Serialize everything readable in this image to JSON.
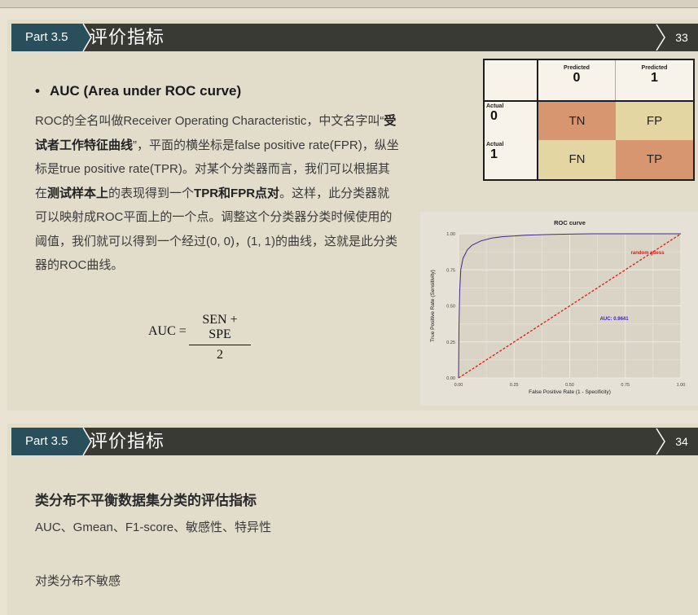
{
  "slide1": {
    "part": "Part 3.5",
    "title": "评价指标",
    "page": "33",
    "bullet": "AUC (Area under ROC curve)",
    "para": [
      {
        "t": "ROC的全名叫做Receiver Operating Characteristic，中文名字叫“",
        "b": false
      },
      {
        "t": "受试者工作特征曲线",
        "b": true
      },
      {
        "t": "”，平面的横坐标是false positive rate(FPR)，纵坐标是true positive rate(TPR)。对某个分类器而言，我们可以根据其在",
        "b": false
      },
      {
        "t": "测试样本上",
        "b": true
      },
      {
        "t": "的表现得到一个",
        "b": false
      },
      {
        "t": "TPR和FPR点对",
        "b": true
      },
      {
        "t": "。这样，此分类器就可以映射成ROC平面上的一个点。调整这个分类器分类时候使用的阈值，我们就可以得到一个经过(0, 0)，(1, 1)的曲线，这就是此分类器的ROC曲线。",
        "b": false
      }
    ],
    "formula": {
      "lhs": "AUC =",
      "numerator": "SEN + SPE",
      "denominator": "2"
    },
    "confusion_matrix": {
      "predicted_label": "Predicted",
      "actual_label": "Actual",
      "col_values": [
        "0",
        "1"
      ],
      "row_values": [
        "0",
        "1"
      ],
      "cells": [
        [
          "TN",
          "FP"
        ],
        [
          "FN",
          "TP"
        ]
      ],
      "colors": {
        "diag": "#d7966f",
        "offdiag": "#e4d6a2"
      }
    }
  },
  "chart_data": {
    "type": "line",
    "title": "ROC curve",
    "xlabel": "False Positive Rate (1 - Specificity)",
    "ylabel": "True Positive Rate (Sensitivity)",
    "xlim": [
      0,
      1
    ],
    "ylim": [
      0,
      1
    ],
    "xticks": [
      "0.00",
      "0.25",
      "0.50",
      "0.75",
      "1.00"
    ],
    "yticks": [
      "0.00",
      "0.25",
      "0.50",
      "0.75",
      "1.00"
    ],
    "grid": true,
    "series": [
      {
        "name": "",
        "color": "#3c2a8c",
        "x": [
          0,
          0.002,
          0.005,
          0.01,
          0.02,
          0.04,
          0.06,
          0.1,
          0.15,
          0.2,
          0.3,
          0.4,
          0.5,
          0.6,
          0.7,
          0.8,
          0.9,
          1.0
        ],
        "y": [
          0,
          0.35,
          0.6,
          0.75,
          0.83,
          0.89,
          0.92,
          0.95,
          0.97,
          0.98,
          0.99,
          0.995,
          0.998,
          1.0,
          1.0,
          1.0,
          1.0,
          1.0
        ]
      },
      {
        "name": "",
        "color": "#e01818",
        "dashed": true,
        "x": [
          0,
          1
        ],
        "y": [
          0,
          1
        ]
      }
    ],
    "annotations": [
      {
        "text": "random guess",
        "x": 0.85,
        "y": 0.86,
        "color": "#e01818"
      },
      {
        "text": "AUC: 0.9641",
        "x": 0.7,
        "y": 0.4,
        "color": "#3a1fc8"
      }
    ]
  },
  "slide2": {
    "part": "Part 3.5",
    "title": "评价指标",
    "page": "34",
    "heading": "类分布不平衡数据集分类的评估指标",
    "line1": "AUC、Gmean、F1-score、敏感性、特异性",
    "line2": "对类分布不敏感"
  }
}
